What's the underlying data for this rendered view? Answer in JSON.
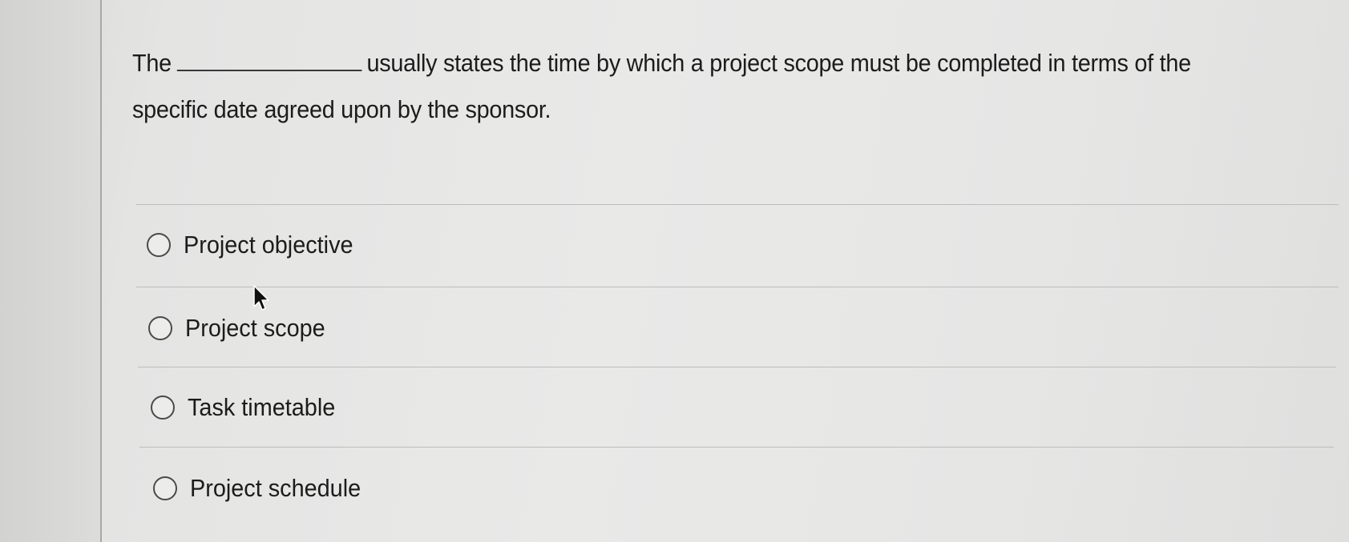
{
  "question": {
    "text_before": "The",
    "text_after": "usually states the time by which a project scope must be completed in terms of the specific date agreed upon by the sponsor."
  },
  "options": [
    {
      "label": "Project objective",
      "selected": false
    },
    {
      "label": "Project scope",
      "selected": false
    },
    {
      "label": "Task timetable",
      "selected": false
    },
    {
      "label": "Project schedule",
      "selected": false
    }
  ],
  "icons": {
    "radio": "radio-circle-icon",
    "pointer": "arrow-cursor-icon"
  },
  "colors": {
    "background": "#e7e7e6",
    "text": "#1c1c1c",
    "divider": "#bdbdbc"
  }
}
